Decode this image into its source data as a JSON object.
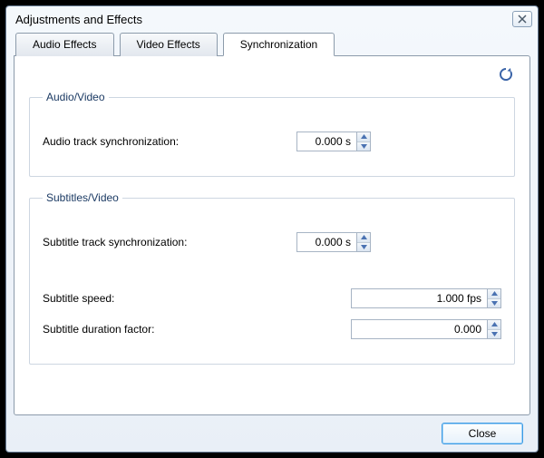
{
  "window": {
    "title": "Adjustments and Effects",
    "close_button_label": "Close"
  },
  "tabs": {
    "t0": "Audio Effects",
    "t1": "Video Effects",
    "t2": "Synchronization",
    "active_index": 2
  },
  "icons": {
    "refresh": "refresh-icon",
    "close_x": "close-icon",
    "spin_up": "chevron-up-icon",
    "spin_down": "chevron-down-icon"
  },
  "sync": {
    "group_audio_video": {
      "legend": "Audio/Video",
      "audio_track_sync": {
        "label": "Audio track synchronization:",
        "value": "0.000 s"
      }
    },
    "group_subtitles_video": {
      "legend": "Subtitles/Video",
      "subtitle_track_sync": {
        "label": "Subtitle track synchronization:",
        "value": "0.000 s"
      },
      "subtitle_speed": {
        "label": "Subtitle speed:",
        "value": "1.000 fps"
      },
      "subtitle_duration_factor": {
        "label": "Subtitle duration factor:",
        "value": "0.000"
      }
    }
  },
  "colors": {
    "accent": "#3c9be4",
    "group_border": "#cdd6e1",
    "text_legend": "#1b3a63"
  }
}
